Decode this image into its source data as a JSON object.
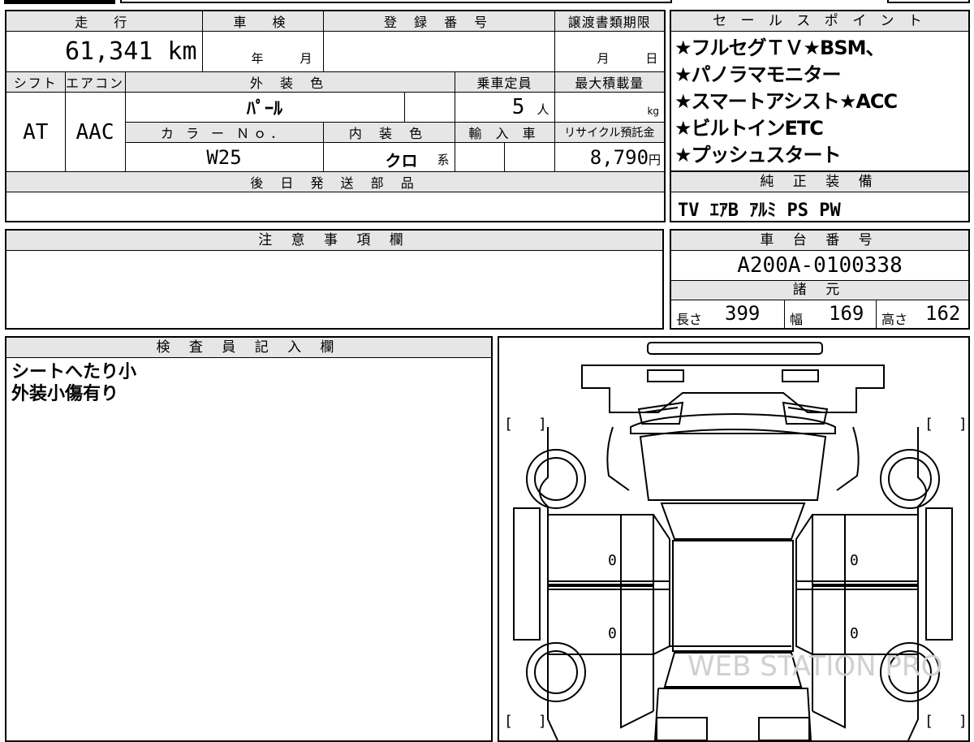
{
  "top": {
    "mileage_label": "走　行",
    "mileage_value": "61,341 km",
    "inspection_label": "車　検",
    "inspection_year_unit": "年",
    "inspection_month_unit": "月",
    "registration_label": "登 録 番 号",
    "registration_value": "",
    "transfer_label": "譲渡書類期限",
    "transfer_month_unit": "月",
    "transfer_day_unit": "日",
    "shift_label": "シフト",
    "shift_value": "AT",
    "ac_label": "エアコン",
    "ac_value": "AAC",
    "exterior_label": "外 装 色",
    "exterior_value": "ﾊﾟｰﾙ",
    "capacity_label": "乗車定員",
    "capacity_value": "5",
    "capacity_unit": "人",
    "maxload_label": "最大積載量",
    "maxload_unit": "kg",
    "colorno_label": "カ ラ ー Ｎｏ．",
    "colorno_value": "W25",
    "interior_label": "内 装 色",
    "interior_value": "クロ",
    "interior_suffix": "系",
    "import_label": "輸 入 車",
    "recycle_label": "リサイクル預託金",
    "recycle_value": "8,790",
    "recycle_unit": "円",
    "later_parts_label": "後 日 発 送 部 品"
  },
  "sales": {
    "header": "セ ー ル ス ポ イ ン ト",
    "lines": [
      "★フルセグＴＶ★BSM、",
      "★パノラマモニター",
      "★スマートアシスト★ACC",
      "★ビルトインETC",
      "★プッシュスタート"
    ]
  },
  "equipment": {
    "header": "純 正 装 備",
    "value": "TV ｴｱB ｱﾙﾐ PS PW"
  },
  "notes": {
    "header": "注 意 事 項 欄"
  },
  "chassis": {
    "header": "車 台 番 号",
    "value": "A200A-0100338",
    "specs_header": "諸 元",
    "length_label": "長さ",
    "length_value": "399",
    "width_label": "幅",
    "width_value": "169",
    "height_label": "高さ",
    "height_value": "162"
  },
  "inspector": {
    "header": "検 査 員 記 入 欄",
    "lines": [
      "シートへたり小",
      "外装小傷有り"
    ]
  },
  "diagram": {
    "mark_front_left": "0",
    "mark_rear_left": "0",
    "mark_front_right": "0",
    "mark_rear_right": "0",
    "watermark": "WEB STATION PRO"
  }
}
